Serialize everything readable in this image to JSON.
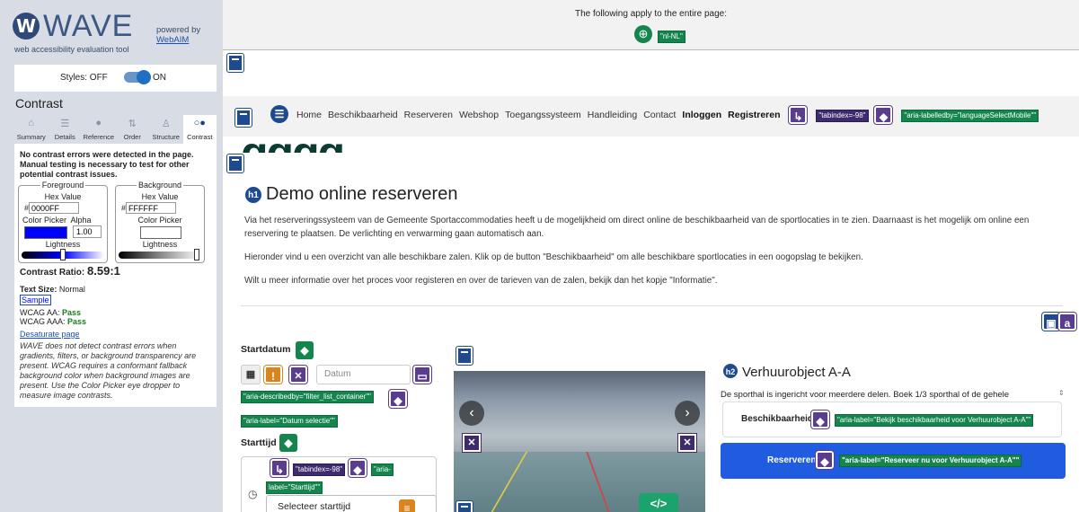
{
  "wave": {
    "logo_letter": "W",
    "logo_text": "WAVE",
    "subtitle": "web accessibility evaluation tool",
    "powered_by": "powered by",
    "webaim_link": "WebAIM",
    "styles_label": "Styles:",
    "styles_off": "OFF",
    "styles_on": "ON",
    "panel_title": "Contrast",
    "tabs": [
      {
        "label": "Summary",
        "icon": "home-icon",
        "glyph": "⌂"
      },
      {
        "label": "Details",
        "icon": "list-icon",
        "glyph": "☰"
      },
      {
        "label": "Reference",
        "icon": "info-icon",
        "glyph": "●"
      },
      {
        "label": "Order",
        "icon": "order-icon",
        "glyph": "⇅"
      },
      {
        "label": "Structure",
        "icon": "structure-icon",
        "glyph": "♙"
      },
      {
        "label": "Contrast",
        "icon": "contrast-icon",
        "glyph": "○●"
      }
    ],
    "contrast": {
      "message": "No contrast errors were detected in the page. Manual testing is necessary to test for other potential contrast issues.",
      "foreground": {
        "legend": "Foreground",
        "hex_label": "Hex Value",
        "hash": "#",
        "hex": "0000FF",
        "picker_label": "Color Picker",
        "alpha_label": "Alpha",
        "alpha": "1.00",
        "lightness_label": "Lightness",
        "swatch": "#0000FF"
      },
      "background": {
        "legend": "Background",
        "hex_label": "Hex Value",
        "hash": "#",
        "hex": "FFFFFF",
        "picker_label": "Color Picker",
        "lightness_label": "Lightness",
        "swatch": "#FFFFFF"
      },
      "ratio_label": "Contrast Ratio:",
      "ratio_value": "8.59:1",
      "text_size_label": "Text Size:",
      "text_size_value": "Normal",
      "sample": "Sample",
      "wcag_aa_label": "WCAG AA:",
      "wcag_aa": "Pass",
      "wcag_aaa_label": "WCAG AAA:",
      "wcag_aaa": "Pass",
      "desaturate": "Desaturate page",
      "note": "WAVE does not detect contrast errors when gradients, filters, or background transparency are present. WCAG requires a conformant fallback background color when background images are present. Use the Color Picker eye dropper to measure image contrasts."
    }
  },
  "page": {
    "lang_notice": "The following apply to the entire page:",
    "lang_tag": "\"nl-NL\"",
    "nav": {
      "items": [
        "Home",
        "Beschikbaarheid",
        "Reserveren",
        "Webshop",
        "Toegangssysteem",
        "Handleiding",
        "Contact"
      ],
      "login": "Inloggen",
      "register": "Registreren",
      "tag1": "\"tabindex=-98\"",
      "tag2": "\"aria-labelledby=\"languageSelectMobile\"\""
    },
    "logo_partial": "ɑɑɑɑ",
    "h1_badge": "h1",
    "h1": "Demo online reserveren",
    "para1": "Via het reserveringssysteem van de Gemeente Sportaccommodaties heeft u de mogelijkheid om direct online de beschikbaarheid van de sportlocaties in te zien. Daarnaast is het mogelijk om online een reservering te plaatsen. De verlichting en verwarming gaan automatisch aan.",
    "para2": "Hieronder vind u een overzicht van alle beschikbare zalen. Klik op de button \"Beschikbaarheid\" om alle beschikbare sportlocaties in een oogopslag te bekijken.",
    "para3": "Wilt u meer informatie over het proces voor registeren en over de tarieven van de zalen, bekijk dan het kopje \"Informatie\".",
    "startdatum": "Startdatum",
    "datum_placeholder": "Datum",
    "tag_describedby": "\"aria-describedby=\"filter_list_container\"\"",
    "tag_datum": "\"aria-label=\"Datum selectie\"\"",
    "starttijd": "Starttijd",
    "tag_tabindex": "\"tabindex=-98\"",
    "tag_aria_start": "\"aria-",
    "tag_label_start": "label=\"Starttijd\"\"",
    "select_starttijd": "Selecteer starttijd",
    "h2_badge": "h2",
    "h2": "Verhuurobject A-A",
    "h2_desc": "De sporthal is ingericht voor meerdere delen. Boek 1/3 sporthal of de gehele",
    "beschikbaarheid_btn": "Beschikbaarheid",
    "tag_beschikbaarheid": "\"aria-label=\"Bekijk beschikbaarheid voor Verhuurobject A-A\"\"",
    "reserveren_btn": "Reserveren",
    "tag_reserveren": "\"aria-label=\"Reserveer nu voor Verhuurobject A-A\"\"",
    "code_glyph": "</>"
  }
}
